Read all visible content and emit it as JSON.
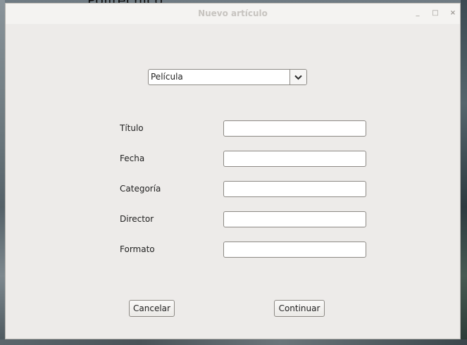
{
  "background": {
    "top_text": "Politecnico"
  },
  "window": {
    "title": "Nuevo artículo",
    "controls": {
      "minimize": "_",
      "maximize": "□",
      "close": "×"
    }
  },
  "type_select": {
    "value": "Película"
  },
  "form": {
    "fields": [
      {
        "label": "Título",
        "value": ""
      },
      {
        "label": "Fecha",
        "value": ""
      },
      {
        "label": "Categoría",
        "value": ""
      },
      {
        "label": "Director",
        "value": ""
      },
      {
        "label": "Formato",
        "value": ""
      }
    ]
  },
  "buttons": {
    "cancel": "Cancelar",
    "continue": "Continuar"
  }
}
